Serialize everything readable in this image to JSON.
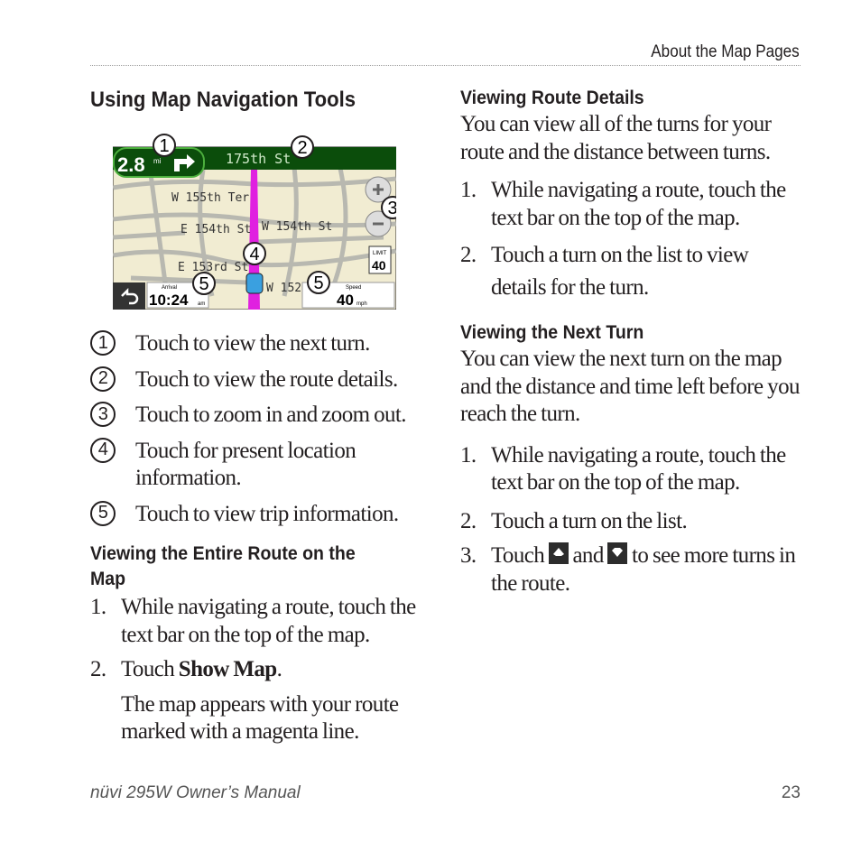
{
  "header": {
    "section": "About the Map Pages"
  },
  "left": {
    "title": "Using Map Navigation Tools",
    "map": {
      "distance": "2.8",
      "distance_unit": "mi",
      "street": "175th St",
      "labels": [
        "W 155th Ter",
        "E 154th St",
        "W 154th St",
        "E 153rd St",
        "W 152"
      ],
      "arrival_label": "Arrival",
      "arrival": "10:24",
      "arrival_suffix": "am",
      "speed_label": "Speed",
      "speed": "40",
      "speed_unit": "mph",
      "limit_label": "LIMIT",
      "limit": "40",
      "route_color": "#e020e0",
      "bar_color": "#0b4d0b",
      "callout_numbers": [
        "1",
        "2",
        "3",
        "4",
        "5",
        "5"
      ]
    },
    "callouts": [
      {
        "num": "1",
        "text": "Touch to view the next turn."
      },
      {
        "num": "2",
        "text": "Touch to view the route details."
      },
      {
        "num": "3",
        "text": "Touch to zoom in and zoom out."
      },
      {
        "num": "4",
        "text": "Touch for present location information."
      },
      {
        "num": "5",
        "text": "Touch to view trip information."
      }
    ],
    "section2": {
      "title": "Viewing the Entire Route on the Map",
      "steps": [
        {
          "num": "1.",
          "text": "While navigating a route, touch the text bar on the top of the map."
        },
        {
          "num": "2.",
          "text_pre": "Touch ",
          "bold": "Show Map",
          "text_post": "."
        }
      ],
      "note": "The map appears with your route marked with a magenta line."
    }
  },
  "right": {
    "section1": {
      "title": "Viewing Route Details",
      "intro": "You can view all of the turns for your route and the distance between turns.",
      "steps": [
        {
          "num": "1.",
          "text": "While navigating a route, touch the text bar on the top of the map."
        },
        {
          "num": "2.",
          "text": "Touch a turn on the list to view details for the turn."
        }
      ]
    },
    "section2": {
      "title": "Viewing the Next Turn",
      "intro": "You can view the next turn on the map and the distance and time left before you reach the turn.",
      "steps": [
        {
          "num": "1.",
          "text": "While navigating a route, touch the text bar on the top of the map."
        },
        {
          "num": "2.",
          "text": "Touch a turn on the list."
        },
        {
          "num": "3.",
          "pre": "Touch",
          "mid": "and",
          "post": "to see more turns in the route.",
          "icons": [
            "up-arrow-icon",
            "down-arrow-icon"
          ]
        }
      ]
    }
  },
  "footer": {
    "manual": "nüvi 295W Owner’s Manual",
    "page": "23"
  }
}
